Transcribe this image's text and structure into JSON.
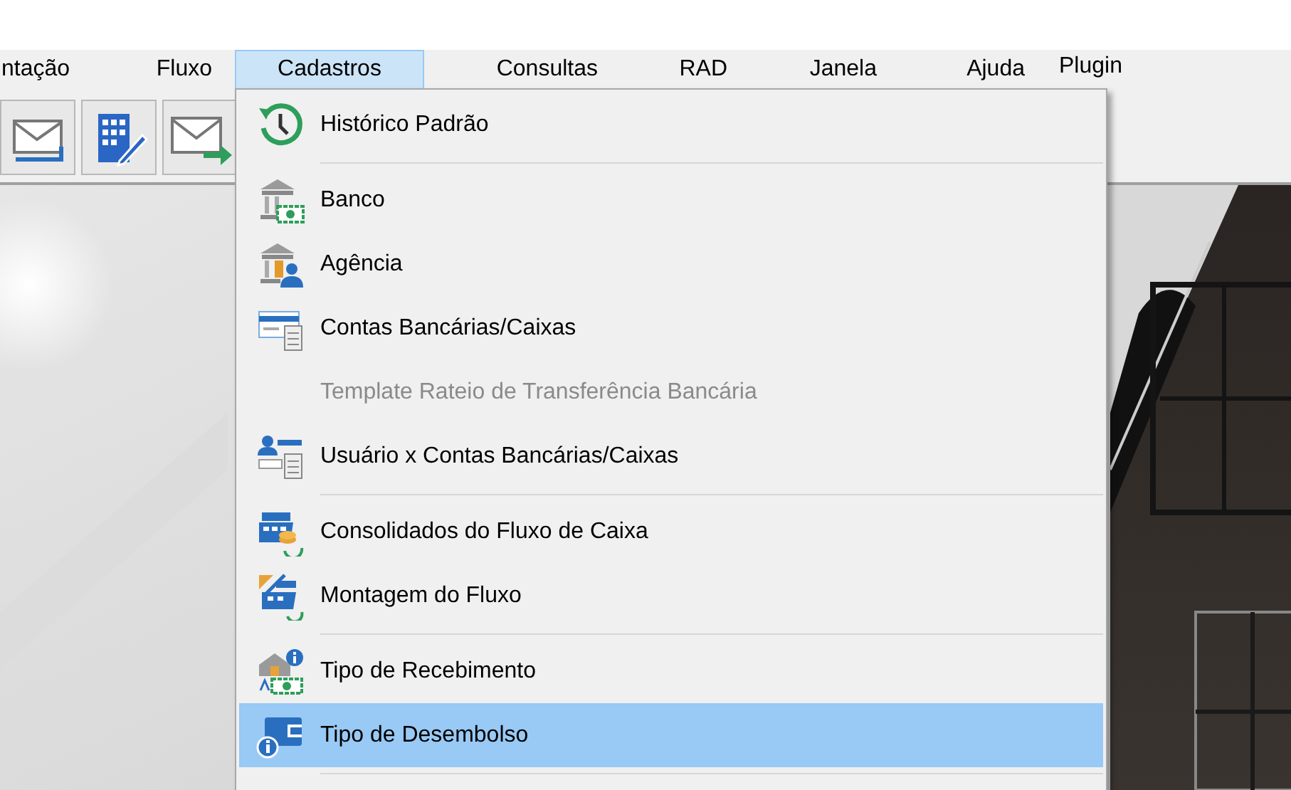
{
  "menu_bar": [
    {
      "label": "ntação",
      "selected": false
    },
    {
      "label": "Fluxo",
      "selected": false
    },
    {
      "label": "Cadastros",
      "selected": true
    },
    {
      "label": "Consultas",
      "selected": false
    },
    {
      "label": "RAD",
      "selected": false
    },
    {
      "label": "Janela",
      "selected": false
    },
    {
      "label": "Ajuda",
      "selected": false
    },
    {
      "label": "Plugin",
      "selected": false
    }
  ],
  "dropdown": {
    "items": [
      {
        "kind": "item",
        "label": "Histórico Padrão",
        "disabled": false,
        "selected": false
      },
      {
        "kind": "separator"
      },
      {
        "kind": "item",
        "label": "Banco",
        "disabled": false,
        "selected": false
      },
      {
        "kind": "item",
        "label": "Agência",
        "disabled": false,
        "selected": false
      },
      {
        "kind": "item",
        "label": "Contas Bancárias/Caixas",
        "disabled": false,
        "selected": false
      },
      {
        "kind": "item",
        "label": "Template Rateio de Transferência Bancária",
        "disabled": true,
        "selected": false
      },
      {
        "kind": "item",
        "label": "Usuário x Contas Bancárias/Caixas",
        "disabled": false,
        "selected": false
      },
      {
        "kind": "separator"
      },
      {
        "kind": "item",
        "label": "Consolidados do Fluxo de Caixa",
        "disabled": false,
        "selected": false
      },
      {
        "kind": "item",
        "label": "Montagem do Fluxo",
        "disabled": false,
        "selected": false
      },
      {
        "kind": "separator"
      },
      {
        "kind": "item",
        "label": "Tipo de Recebimento",
        "disabled": false,
        "selected": false
      },
      {
        "kind": "item",
        "label": "Tipo de Desembolso",
        "disabled": false,
        "selected": true
      },
      {
        "kind": "separator"
      }
    ]
  }
}
